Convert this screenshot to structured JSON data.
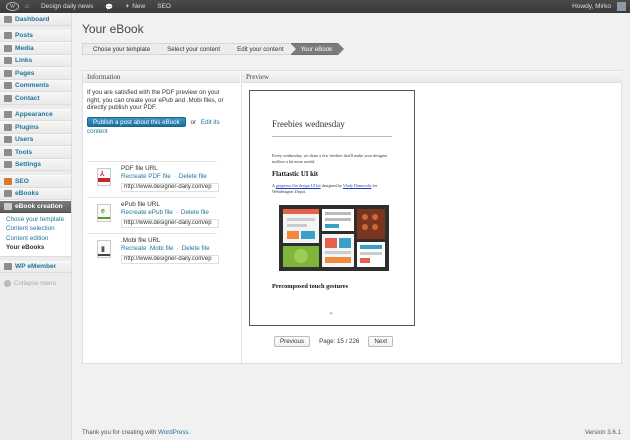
{
  "adminbar": {
    "site_name": "Design daily news",
    "new_label": "New",
    "seo_label": "SEO",
    "greeting": "Howdy, Mirko",
    "plus_glyph": "+"
  },
  "sidebar": {
    "items": [
      {
        "label": "Dashboard",
        "icon": "dashboard-icon"
      },
      {
        "label": "Posts",
        "icon": "posts-icon"
      },
      {
        "label": "Media",
        "icon": "media-icon"
      },
      {
        "label": "Links",
        "icon": "links-icon"
      },
      {
        "label": "Pages",
        "icon": "pages-icon"
      },
      {
        "label": "Comments",
        "icon": "comments-icon"
      },
      {
        "label": "Contact",
        "icon": "contact-icon"
      },
      {
        "label": "Appearance",
        "icon": "appearance-icon"
      },
      {
        "label": "Plugins",
        "icon": "plugins-icon"
      },
      {
        "label": "Users",
        "icon": "users-icon"
      },
      {
        "label": "Tools",
        "icon": "tools-icon"
      },
      {
        "label": "Settings",
        "icon": "settings-icon"
      },
      {
        "label": "SEO",
        "icon": "seo-icon"
      },
      {
        "label": "eBooks",
        "icon": "ebooks-icon"
      },
      {
        "label": "eBook creation",
        "icon": "ebook-creation-icon"
      }
    ],
    "submenu": [
      "Chose your template",
      "Content selection",
      "Content edition",
      "Your eBooks"
    ],
    "after": {
      "label": "WP eMember",
      "icon": "member-icon"
    },
    "collapse_label": "Collapse menu"
  },
  "page": {
    "title": "Your eBook",
    "steps": [
      "Chose your template",
      "Select your content",
      "Edit your content",
      "Your eBook"
    ]
  },
  "info": {
    "heading": "Information",
    "text": "If you are satisfied with the PDF preview on your right, you can create your ePub and .Mobi files, or directly publish your PDF.",
    "publish_button": "Publish a post about this eBook",
    "or_text": "or",
    "edit_link": "Edit its content",
    "files": [
      {
        "title": "PDF file URL",
        "recreate": "Recreate PDF file",
        "delete": "Delete file",
        "url": "http://www.designer-daily.com/ep"
      },
      {
        "title": "ePub file URL",
        "recreate": "Recreate ePub file",
        "delete": "Delete file",
        "url": "http://www.designer-daily.com/ep"
      },
      {
        "title": ".Mobi file URL",
        "recreate": "Recreate .Mobi file",
        "delete": "Delete file",
        "url": "http://www.designer-daily.com/ep"
      }
    ]
  },
  "preview": {
    "heading": "Preview",
    "book": {
      "title": "Freebies wednesday",
      "intro": "Every wednesday, we share a few freebies that'll make your designer toolbox a bit more useful.",
      "heading": "Flattastic UI kit",
      "desc_prefix": "A",
      "desc_link1": "gorgeous flat design UI kit",
      "desc_mid": "designed by",
      "desc_link2": "Vlady Damovski",
      "desc_suffix": "for Webdesigner Depot.",
      "heading2": "Precomposed touch gestures",
      "page_mark": "P"
    },
    "pager": {
      "prev": "Previous",
      "info": "Page: 15 / 226",
      "next": "Next"
    }
  },
  "footer": {
    "text": "Thank you for creating with",
    "link": "WordPress",
    "period": ".",
    "version": "Version 3.6.1"
  },
  "colors": {
    "accent": "#21759b",
    "active_menu": "#6b6b6b",
    "pdf_red": "#c92626",
    "epub_green": "#5a9b23"
  }
}
